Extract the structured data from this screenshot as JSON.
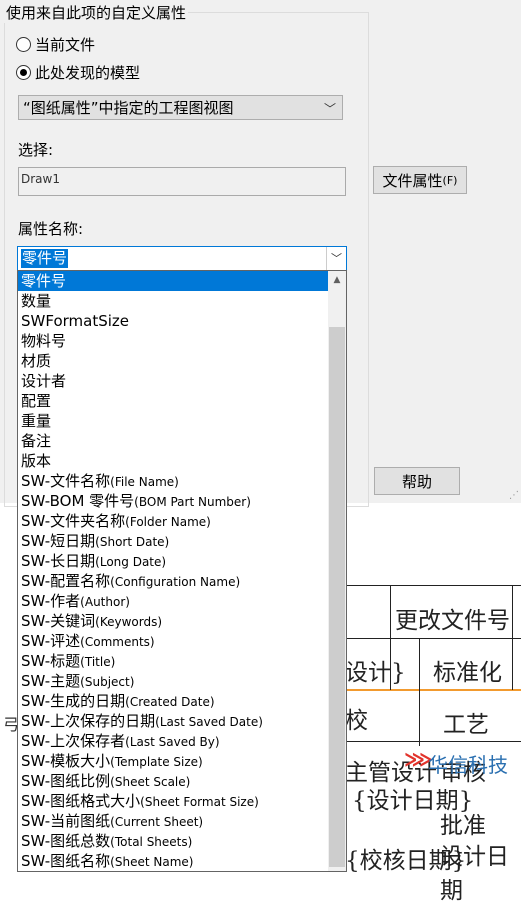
{
  "dialog": {
    "group_title": "使用来自此项的自定义属性",
    "radio_current_file": "当前文件",
    "radio_found_model": "此处发现的模型",
    "source_combo_value": "“图纸属性”中指定的工程图视图",
    "select_label": "选择:",
    "select_value": "Draw1",
    "file_props_button": "文件属性",
    "file_props_shortcut": "(F)",
    "prop_name_label": "属性名称:",
    "prop_name_value": "零件号",
    "help_button": "帮助"
  },
  "dropdown": {
    "items": [
      {
        "zh": "零件号",
        "en": "",
        "selected": true
      },
      {
        "zh": "数量",
        "en": ""
      },
      {
        "zh": "SWFormatSize",
        "en": ""
      },
      {
        "zh": "物料号",
        "en": ""
      },
      {
        "zh": "材质",
        "en": ""
      },
      {
        "zh": "设计者",
        "en": ""
      },
      {
        "zh": "配置",
        "en": ""
      },
      {
        "zh": "重量",
        "en": ""
      },
      {
        "zh": "备注",
        "en": ""
      },
      {
        "zh": "版本",
        "en": ""
      },
      {
        "zh": "SW-文件名称",
        "en": "(File Name)"
      },
      {
        "zh": "SW-BOM 零件号",
        "en": "(BOM Part Number)"
      },
      {
        "zh": "SW-文件夹名称",
        "en": "(Folder Name)"
      },
      {
        "zh": "SW-短日期",
        "en": "(Short Date)"
      },
      {
        "zh": "SW-长日期",
        "en": "(Long Date)"
      },
      {
        "zh": "SW-配置名称",
        "en": "(Configuration Name)"
      },
      {
        "zh": "SW-作者",
        "en": "(Author)"
      },
      {
        "zh": "SW-关键词",
        "en": "(Keywords)"
      },
      {
        "zh": "SW-评述",
        "en": "(Comments)"
      },
      {
        "zh": "SW-标题",
        "en": "(Title)"
      },
      {
        "zh": "SW-主题",
        "en": "(Subject)"
      },
      {
        "zh": "SW-生成的日期",
        "en": "(Created Date)"
      },
      {
        "zh": "SW-上次保存的日期",
        "en": "(Last Saved Date)"
      },
      {
        "zh": "SW-上次保存者",
        "en": "(Last Saved By)"
      },
      {
        "zh": "SW-模板大小",
        "en": "(Template Size)"
      },
      {
        "zh": "SW-图纸比例",
        "en": "(Sheet Scale)"
      },
      {
        "zh": "SW-图纸格式大小",
        "en": "(Sheet Format Size)"
      },
      {
        "zh": "SW-当前图纸",
        "en": "(Current Sheet)"
      },
      {
        "zh": "SW-图纸总数",
        "en": "(Total Sheets)"
      },
      {
        "zh": "SW-图纸名称",
        "en": "(Sheet Name)"
      }
    ]
  },
  "drawing": {
    "cell_change_doc": "更改文件号",
    "cell_design": "设计}",
    "cell_standard": "标准化",
    "cell_check": "校",
    "cell_craft": "工艺",
    "cell_chief": "主管设计",
    "cell_audit": "审核",
    "cell_design_date": "{设计日期}",
    "cell_approve": "批准",
    "cell_bottom": "{校核日期}",
    "cell_bottom2": "设计日期",
    "left_char": "弓",
    "logo_text": "华信科技"
  },
  "colors": {
    "accent": "#0078d7",
    "title_line": "#f29a2e",
    "logo_red": "#e2332b",
    "logo_blue": "#2a6fb0"
  }
}
